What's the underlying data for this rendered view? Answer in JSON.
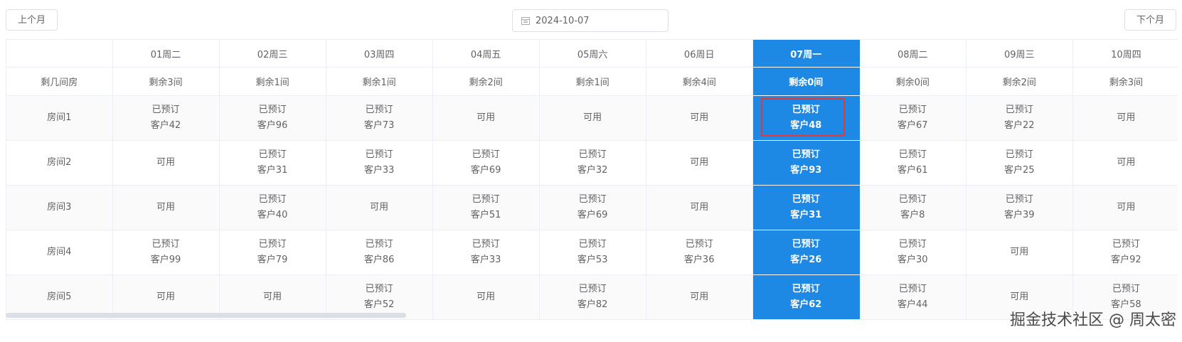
{
  "toolbar": {
    "prev_label": "上个月",
    "next_label": "下个月",
    "date_value": "2024-10-07",
    "date_icon": "calendar-icon"
  },
  "header": {
    "corner": "",
    "remain_label": "剩几间房",
    "days": [
      {
        "day": "01周二",
        "remain": "剩余3间"
      },
      {
        "day": "02周三",
        "remain": "剩余1间"
      },
      {
        "day": "03周四",
        "remain": "剩余1间"
      },
      {
        "day": "04周五",
        "remain": "剩余2间"
      },
      {
        "day": "05周六",
        "remain": "剩余1间"
      },
      {
        "day": "06周日",
        "remain": "剩余4间"
      },
      {
        "day": "07周一",
        "remain": "剩余0间"
      },
      {
        "day": "08周二",
        "remain": "剩余0间"
      },
      {
        "day": "09周三",
        "remain": "剩余2间"
      },
      {
        "day": "10周四",
        "remain": "剩余3间"
      }
    ]
  },
  "today_index": 6,
  "selected": {
    "room": 0,
    "day": 6
  },
  "rooms": [
    {
      "name": "房间1",
      "cells": [
        [
          "已预订",
          "客户42"
        ],
        [
          "已预订",
          "客户96"
        ],
        [
          "已预订",
          "客户73"
        ],
        [
          "可用"
        ],
        [
          "可用"
        ],
        [
          "可用"
        ],
        [
          "已预订",
          "客户48"
        ],
        [
          "已预订",
          "客户67"
        ],
        [
          "已预订",
          "客户22"
        ],
        [
          "可用"
        ]
      ]
    },
    {
      "name": "房间2",
      "cells": [
        [
          "可用"
        ],
        [
          "已预订",
          "客户31"
        ],
        [
          "已预订",
          "客户33"
        ],
        [
          "已预订",
          "客户69"
        ],
        [
          "已预订",
          "客户32"
        ],
        [
          "可用"
        ],
        [
          "已预订",
          "客户93"
        ],
        [
          "已预订",
          "客户61"
        ],
        [
          "已预订",
          "客户25"
        ],
        [
          "可用"
        ]
      ]
    },
    {
      "name": "房间3",
      "cells": [
        [
          "可用"
        ],
        [
          "已预订",
          "客户40"
        ],
        [
          "可用"
        ],
        [
          "已预订",
          "客户51"
        ],
        [
          "已预订",
          "客户69"
        ],
        [
          "可用"
        ],
        [
          "已预订",
          "客户31"
        ],
        [
          "已预订",
          "客户8"
        ],
        [
          "已预订",
          "客户39"
        ],
        [
          "可用"
        ]
      ]
    },
    {
      "name": "房间4",
      "cells": [
        [
          "已预订",
          "客户99"
        ],
        [
          "已预订",
          "客户79"
        ],
        [
          "已预订",
          "客户86"
        ],
        [
          "已预订",
          "客户33"
        ],
        [
          "已预订",
          "客户53"
        ],
        [
          "已预订",
          "客户36"
        ],
        [
          "已预订",
          "客户26"
        ],
        [
          "已预订",
          "客户30"
        ],
        [
          "可用"
        ],
        [
          "已预订",
          "客户92"
        ]
      ]
    },
    {
      "name": "房间5",
      "cells": [
        [
          "可用"
        ],
        [
          "可用"
        ],
        [
          "已预订",
          "客户52"
        ],
        [
          "可用"
        ],
        [
          "已预订",
          "客户82"
        ],
        [
          "可用"
        ],
        [
          "已预订",
          "客户62"
        ],
        [
          "已预订",
          "客户44"
        ],
        [
          "可用"
        ],
        [
          "已预订",
          "客户58"
        ]
      ]
    }
  ],
  "colors": {
    "today": "#1e88e5",
    "selection": "#e53935"
  },
  "watermark": "掘金技术社区 @ 周太密"
}
